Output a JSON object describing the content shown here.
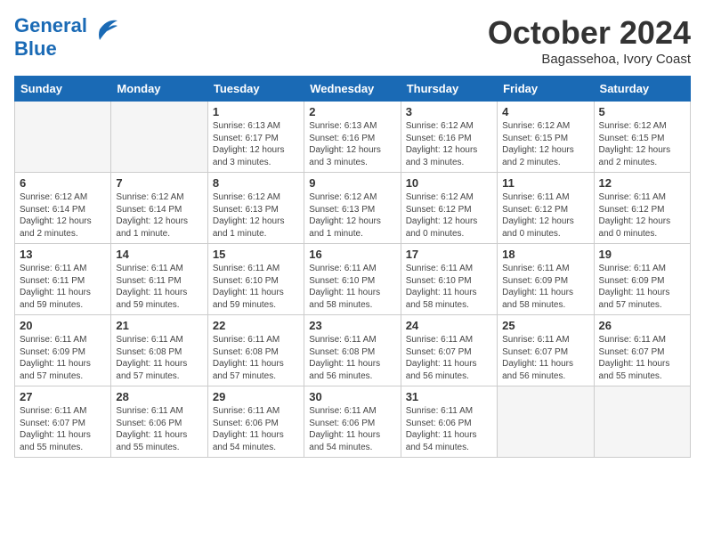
{
  "header": {
    "logo_line1": "General",
    "logo_line2": "Blue",
    "month": "October 2024",
    "location": "Bagassehoa, Ivory Coast"
  },
  "days_of_week": [
    "Sunday",
    "Monday",
    "Tuesday",
    "Wednesday",
    "Thursday",
    "Friday",
    "Saturday"
  ],
  "weeks": [
    [
      {
        "day": "",
        "empty": true
      },
      {
        "day": "",
        "empty": true
      },
      {
        "day": "1",
        "sunrise": "Sunrise: 6:13 AM",
        "sunset": "Sunset: 6:17 PM",
        "daylight": "Daylight: 12 hours and 3 minutes."
      },
      {
        "day": "2",
        "sunrise": "Sunrise: 6:13 AM",
        "sunset": "Sunset: 6:16 PM",
        "daylight": "Daylight: 12 hours and 3 minutes."
      },
      {
        "day": "3",
        "sunrise": "Sunrise: 6:12 AM",
        "sunset": "Sunset: 6:16 PM",
        "daylight": "Daylight: 12 hours and 3 minutes."
      },
      {
        "day": "4",
        "sunrise": "Sunrise: 6:12 AM",
        "sunset": "Sunset: 6:15 PM",
        "daylight": "Daylight: 12 hours and 2 minutes."
      },
      {
        "day": "5",
        "sunrise": "Sunrise: 6:12 AM",
        "sunset": "Sunset: 6:15 PM",
        "daylight": "Daylight: 12 hours and 2 minutes."
      }
    ],
    [
      {
        "day": "6",
        "sunrise": "Sunrise: 6:12 AM",
        "sunset": "Sunset: 6:14 PM",
        "daylight": "Daylight: 12 hours and 2 minutes."
      },
      {
        "day": "7",
        "sunrise": "Sunrise: 6:12 AM",
        "sunset": "Sunset: 6:14 PM",
        "daylight": "Daylight: 12 hours and 1 minute."
      },
      {
        "day": "8",
        "sunrise": "Sunrise: 6:12 AM",
        "sunset": "Sunset: 6:13 PM",
        "daylight": "Daylight: 12 hours and 1 minute."
      },
      {
        "day": "9",
        "sunrise": "Sunrise: 6:12 AM",
        "sunset": "Sunset: 6:13 PM",
        "daylight": "Daylight: 12 hours and 1 minute."
      },
      {
        "day": "10",
        "sunrise": "Sunrise: 6:12 AM",
        "sunset": "Sunset: 6:12 PM",
        "daylight": "Daylight: 12 hours and 0 minutes."
      },
      {
        "day": "11",
        "sunrise": "Sunrise: 6:11 AM",
        "sunset": "Sunset: 6:12 PM",
        "daylight": "Daylight: 12 hours and 0 minutes."
      },
      {
        "day": "12",
        "sunrise": "Sunrise: 6:11 AM",
        "sunset": "Sunset: 6:12 PM",
        "daylight": "Daylight: 12 hours and 0 minutes."
      }
    ],
    [
      {
        "day": "13",
        "sunrise": "Sunrise: 6:11 AM",
        "sunset": "Sunset: 6:11 PM",
        "daylight": "Daylight: 11 hours and 59 minutes."
      },
      {
        "day": "14",
        "sunrise": "Sunrise: 6:11 AM",
        "sunset": "Sunset: 6:11 PM",
        "daylight": "Daylight: 11 hours and 59 minutes."
      },
      {
        "day": "15",
        "sunrise": "Sunrise: 6:11 AM",
        "sunset": "Sunset: 6:10 PM",
        "daylight": "Daylight: 11 hours and 59 minutes."
      },
      {
        "day": "16",
        "sunrise": "Sunrise: 6:11 AM",
        "sunset": "Sunset: 6:10 PM",
        "daylight": "Daylight: 11 hours and 58 minutes."
      },
      {
        "day": "17",
        "sunrise": "Sunrise: 6:11 AM",
        "sunset": "Sunset: 6:10 PM",
        "daylight": "Daylight: 11 hours and 58 minutes."
      },
      {
        "day": "18",
        "sunrise": "Sunrise: 6:11 AM",
        "sunset": "Sunset: 6:09 PM",
        "daylight": "Daylight: 11 hours and 58 minutes."
      },
      {
        "day": "19",
        "sunrise": "Sunrise: 6:11 AM",
        "sunset": "Sunset: 6:09 PM",
        "daylight": "Daylight: 11 hours and 57 minutes."
      }
    ],
    [
      {
        "day": "20",
        "sunrise": "Sunrise: 6:11 AM",
        "sunset": "Sunset: 6:09 PM",
        "daylight": "Daylight: 11 hours and 57 minutes."
      },
      {
        "day": "21",
        "sunrise": "Sunrise: 6:11 AM",
        "sunset": "Sunset: 6:08 PM",
        "daylight": "Daylight: 11 hours and 57 minutes."
      },
      {
        "day": "22",
        "sunrise": "Sunrise: 6:11 AM",
        "sunset": "Sunset: 6:08 PM",
        "daylight": "Daylight: 11 hours and 57 minutes."
      },
      {
        "day": "23",
        "sunrise": "Sunrise: 6:11 AM",
        "sunset": "Sunset: 6:08 PM",
        "daylight": "Daylight: 11 hours and 56 minutes."
      },
      {
        "day": "24",
        "sunrise": "Sunrise: 6:11 AM",
        "sunset": "Sunset: 6:07 PM",
        "daylight": "Daylight: 11 hours and 56 minutes."
      },
      {
        "day": "25",
        "sunrise": "Sunrise: 6:11 AM",
        "sunset": "Sunset: 6:07 PM",
        "daylight": "Daylight: 11 hours and 56 minutes."
      },
      {
        "day": "26",
        "sunrise": "Sunrise: 6:11 AM",
        "sunset": "Sunset: 6:07 PM",
        "daylight": "Daylight: 11 hours and 55 minutes."
      }
    ],
    [
      {
        "day": "27",
        "sunrise": "Sunrise: 6:11 AM",
        "sunset": "Sunset: 6:07 PM",
        "daylight": "Daylight: 11 hours and 55 minutes."
      },
      {
        "day": "28",
        "sunrise": "Sunrise: 6:11 AM",
        "sunset": "Sunset: 6:06 PM",
        "daylight": "Daylight: 11 hours and 55 minutes."
      },
      {
        "day": "29",
        "sunrise": "Sunrise: 6:11 AM",
        "sunset": "Sunset: 6:06 PM",
        "daylight": "Daylight: 11 hours and 54 minutes."
      },
      {
        "day": "30",
        "sunrise": "Sunrise: 6:11 AM",
        "sunset": "Sunset: 6:06 PM",
        "daylight": "Daylight: 11 hours and 54 minutes."
      },
      {
        "day": "31",
        "sunrise": "Sunrise: 6:11 AM",
        "sunset": "Sunset: 6:06 PM",
        "daylight": "Daylight: 11 hours and 54 minutes."
      },
      {
        "day": "",
        "empty": true
      },
      {
        "day": "",
        "empty": true
      }
    ]
  ]
}
